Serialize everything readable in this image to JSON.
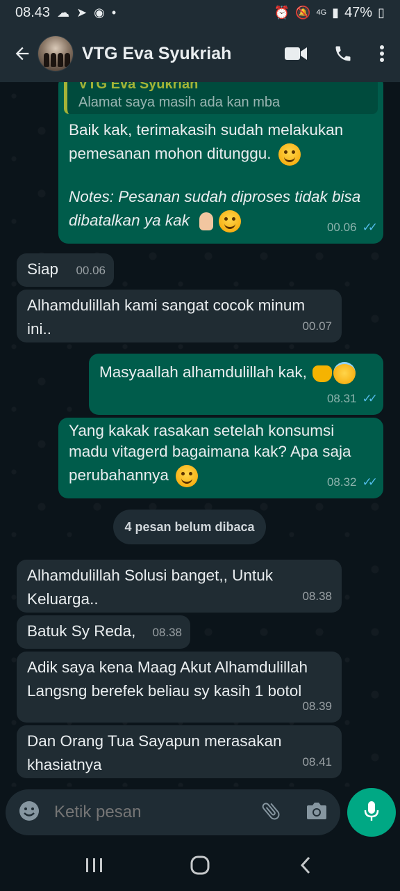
{
  "status_bar": {
    "time": "08.43",
    "battery": "47%",
    "network": "4G"
  },
  "header": {
    "contact_name": "VTG Eva Syukriah",
    "icons": [
      "back-arrow-icon",
      "video-call-icon",
      "voice-call-icon",
      "more-vert-icon"
    ]
  },
  "messages": [
    {
      "direction": "out",
      "quote_author": "VTG Eva Syukriah",
      "quote_text": "Alamat saya masih ada kan mba",
      "line1": "Baik kak, terimakasih sudah melakukan",
      "line2": "pemesanan mohon ditunggu.",
      "line3": "Notes: Pesanan sudah diproses tidak bisa",
      "line4": "dibatalkan ya kak",
      "time": "00.06"
    },
    {
      "direction": "in",
      "text": "Siap",
      "time": "00.06"
    },
    {
      "direction": "in",
      "line1": "Alhamdulillah kami sangat cocok minum",
      "line2": "ini..",
      "time": "00.07"
    },
    {
      "direction": "out",
      "text": "Masyaallah alhamdulillah kak,",
      "time": "08.31"
    },
    {
      "direction": "out",
      "line1": "Yang kakak rasakan setelah konsumsi",
      "line2": "madu vitagerd bagaimana kak? Apa saja",
      "line3": "perubahannya",
      "time": "08.32"
    },
    {
      "direction": "in",
      "line1": "Alhamdulillah Solusi banget,, Untuk",
      "line2": "Keluarga..",
      "time": "08.38"
    },
    {
      "direction": "in",
      "text": "Batuk Sy Reda,",
      "time": "08.38"
    },
    {
      "direction": "in",
      "line1": "Adik saya kena Maag Akut Alhamdulillah",
      "line2": "Langsng berefek beliau sy kasih 1 botol",
      "time": "08.39"
    },
    {
      "direction": "in",
      "line1": "Dan Orang Tua Sayapun merasakan",
      "line2": "khasiatnya",
      "time": "08.41"
    }
  ],
  "unread_banner": "4 pesan belum dibaca",
  "composer": {
    "placeholder": "Ketik pesan",
    "icons": [
      "emoji-icon",
      "attach-icon",
      "camera-icon",
      "mic-icon"
    ]
  },
  "colors": {
    "outgoing_bubble": "#005c4b",
    "incoming_bubble": "#202c33",
    "accent": "#00a884",
    "read_ticks": "#53bdeb"
  }
}
